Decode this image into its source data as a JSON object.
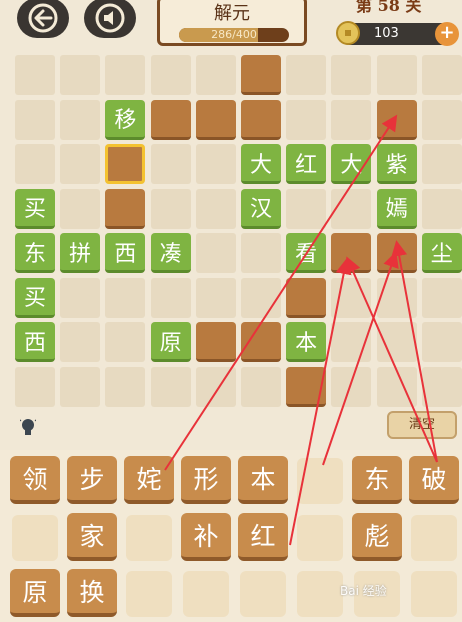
{
  "header": {
    "title": "解元",
    "progress_text": "286/400",
    "progress_value": 0.715,
    "level_text": "第 58 关",
    "coins": "103"
  },
  "icons": {
    "back": "arrow-left-icon",
    "sound": "speaker-icon",
    "coin": "coin-icon",
    "add": "plus-icon",
    "hint": "lightbulb-icon"
  },
  "board": {
    "tiles": [
      {
        "id": "r1c6",
        "type": "empty",
        "text": ""
      },
      {
        "id": "r2c3",
        "type": "word",
        "text": "移"
      },
      {
        "id": "r2c4",
        "type": "empty",
        "text": ""
      },
      {
        "id": "r2c5",
        "type": "empty",
        "text": ""
      },
      {
        "id": "r2c6",
        "type": "empty",
        "text": ""
      },
      {
        "id": "r2c9",
        "type": "empty",
        "text": ""
      },
      {
        "id": "r3c3",
        "type": "selected",
        "text": ""
      },
      {
        "id": "r3c6",
        "type": "word",
        "text": "大"
      },
      {
        "id": "r3c7",
        "type": "word",
        "text": "红"
      },
      {
        "id": "r3c8",
        "type": "word",
        "text": "大"
      },
      {
        "id": "r3c9",
        "type": "word",
        "text": "紫"
      },
      {
        "id": "r4c1",
        "type": "word",
        "text": "买"
      },
      {
        "id": "r4c3",
        "type": "empty",
        "text": ""
      },
      {
        "id": "r4c6",
        "type": "word",
        "text": "汉"
      },
      {
        "id": "r4c9",
        "type": "word",
        "text": "嫣"
      },
      {
        "id": "r5c1",
        "type": "word",
        "text": "东"
      },
      {
        "id": "r5c2",
        "type": "word",
        "text": "拼"
      },
      {
        "id": "r5c3",
        "type": "word",
        "text": "西"
      },
      {
        "id": "r5c4",
        "type": "word",
        "text": "凑"
      },
      {
        "id": "r5c7",
        "type": "word",
        "text": "看"
      },
      {
        "id": "r5c8",
        "type": "empty",
        "text": ""
      },
      {
        "id": "r5c9",
        "type": "empty",
        "text": ""
      },
      {
        "id": "r5c10",
        "type": "word",
        "text": "尘"
      },
      {
        "id": "r6c1",
        "type": "word",
        "text": "买"
      },
      {
        "id": "r6c7",
        "type": "empty",
        "text": ""
      },
      {
        "id": "r7c1",
        "type": "word",
        "text": "西"
      },
      {
        "id": "r7c4",
        "type": "word",
        "text": "原"
      },
      {
        "id": "r7c5",
        "type": "empty",
        "text": ""
      },
      {
        "id": "r7c6",
        "type": "empty",
        "text": ""
      },
      {
        "id": "r7c7",
        "type": "word",
        "text": "本"
      },
      {
        "id": "r8c7",
        "type": "empty",
        "text": ""
      }
    ]
  },
  "controls": {
    "clear_label": "清空"
  },
  "tray": {
    "tiles": [
      "领",
      "步",
      "姹",
      "形",
      "本",
      "东",
      "破",
      "家",
      "补",
      "红",
      "彪",
      "原",
      "换"
    ]
  },
  "watermark": "Bai 经验"
}
